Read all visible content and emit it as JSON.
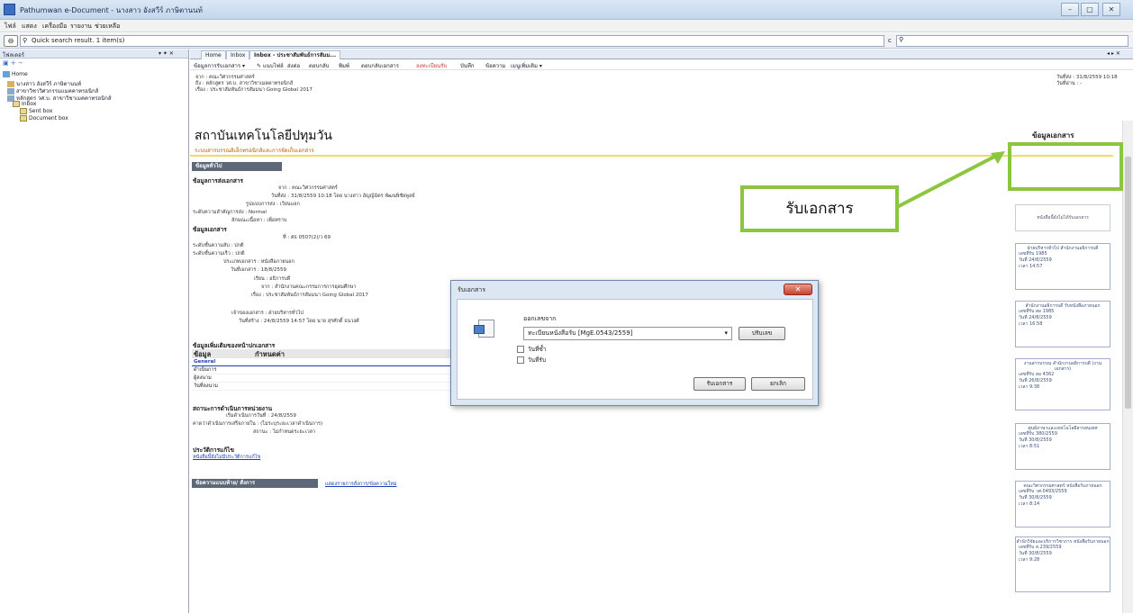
{
  "window": {
    "title": "Pathumwan e-Document - นางสาว อังสวีร์ ภาษิตานนท์",
    "controls": [
      "–",
      "▢",
      "✕"
    ]
  },
  "menubar": {
    "items": [
      "ไฟล์",
      "แสดง",
      "เครื่องมือ",
      "รายงาน",
      "ช่วยเหลือ"
    ]
  },
  "search": {
    "value": "Quick search result. 1 item(s)",
    "dropdown": "c"
  },
  "left_panel": {
    "title": "โฟลเดอร์",
    "controls": "▾ ✦ ✕",
    "tree": [
      {
        "label": "Home",
        "indent": 0
      },
      {
        "label": "นางสาว อังสวีร์ ภาษิตานนท์",
        "indent": 1
      },
      {
        "label": "สาขาวิชาวิศวกรรมแมคคาทรอนิกส์",
        "indent": 1
      },
      {
        "label": "หลักสูตร วศ.บ. สาขาวิชาเมคคาทรอนิกส์",
        "indent": 1
      },
      {
        "label": "Inbox",
        "indent": 2
      },
      {
        "label": "Sent box",
        "indent": 3
      },
      {
        "label": "Document box",
        "indent": 3
      }
    ]
  },
  "tabs": [
    "Home",
    "Inbox",
    "Inbox - ประชาสัมพันธ์การสัมม..."
  ],
  "tab_controls": "◂ ▸ ✕",
  "toolbar": {
    "items": [
      "ข้อมูลการรับเอกสาร ▾",
      "✎ แนบไฟล์",
      "ส่งต่อ",
      "ตอบกลับ",
      "พิมพ์",
      "ตอบกลับเอกสาร",
      "ลงทะเบียนรับ",
      "บันทึก",
      "ข้อความ",
      "เมนูเพิ่มเติม ▾"
    ]
  },
  "meta": {
    "from": "จาก : คณะวิศวกรรมศาสตร์",
    "to": "ถึง : หลักสูตร วศ.บ. สาขาวิชาเมคคาทรอนิกส์",
    "subject": "เรื่อง : ประชาสัมพันธ์การสัมมนา Going Global 2017",
    "date_sent": "วันที่ส่ง : 31/8/2559 10:18",
    "date_read": "วันที่อ่าน : -"
  },
  "doc": {
    "org_title": "สถาบันเทคโนโลยีปทุมวัน",
    "org_sub": "ระบบสารบรรณอิเล็กทรอนิกส์และการจัดเก็บเอกสาร",
    "doc_info_title": "ข้อมูลเอกสาร",
    "general_tab": "ข้อมูลทั่วไป",
    "sender_heading": "ข้อมูลการส่งเอกสาร",
    "sender_lines": [
      "จาก : คณะวิศวกรรมศาสตร์",
      "วันที่ส่ง : 31/8/2559 10:18 โดย นางสาว อัญญ์ฉัตร พัฒนพิชัยพูลย์",
      "รูปแบบการส่ง : เวียนแจก",
      "ระดับความสำคัญการส่ง : Normal",
      "ลักษณะเนื้อหา : เพื่อทราบ"
    ],
    "doc_heading": "ข้อมูลเอกสาร",
    "doc_lines": [
      "ที่ : ศธ 0507(2)/ว 69",
      "ระดับชั้นความลับ : ปกติ",
      "ระดับชั้นความเร็ว : ปกติ",
      "ประเภทเอกสาร : หนังสือภายนอก",
      "วันที่เอกสาร : 18/8/2559",
      "เรียน : อธิการบดี",
      "จาก : สำนักงานคณะกรรมการการอุดมศึกษา",
      "เรื่อง : ประชาสัมพันธ์การสัมมนา Going Global 2017"
    ],
    "owner_lines": [
      "เจ้าของเอกสาร : ฝ่ายบริหารทั่วไป",
      "วันที่สร้าง : 24/8/2559 14:57 โดย นาย สุรศักดิ์ ธนวงศ์"
    ],
    "extra_heading": "ข้อมูลเพิ่มเติมของหน้าปกเอกสาร",
    "param_cols": [
      "ข้อมูล",
      "กำหนดค่า"
    ],
    "param_rows": [
      "General",
      "ดำเนินการ",
      "ผู้ลงนาม",
      "วันที่ลงนาม"
    ],
    "status_heading": "สถานะการดำเนินการหน่วยงาน",
    "status_lines": [
      "เริ่มดำเนินการวันที่ : 24/8/2559",
      "คาดว่าดำเนินการเสร็จภายใน : (ไม่ระบุระยะเวลาดำเนินการ)",
      "สถานะ : ไม่กำหนดระยะเวลา"
    ],
    "history_heading": "ประวัติการแก้ไข",
    "history_link": "หนังสือนี้ยังไม่มีประวัติการแก้ไข",
    "bottom_bar": "ข้อความแนบท้าย/ สั่งการ",
    "bottom_link": "แสดงรายการสั่งการ/ข้อความใหม่"
  },
  "sidebar": {
    "accept_link": "หนังสือนี้ยังไม่ได้รับเอกสาร",
    "routes": [
      {
        "title": "ฝ่ายบริหารทั่วไป สำนักงานอธิการบดี",
        "lines": [
          "เลขที่รับ 1985",
          "วันที่ 24/8/2559",
          "เวลา 14:57"
        ]
      },
      {
        "title": "สำนักงานอธิการบดี รับหนังสือภายนอก",
        "lines": [
          "เลขที่รับ สอ 1985",
          "วันที่ 24/8/2559",
          "เวลา 16:58"
        ]
      },
      {
        "title": "งานสารบรรณ สำนักงานอธิการบดี (งานเอกสาร)",
        "lines": [
          "เลขที่รับ สอ 4362",
          "วันที่ 26/8/2559",
          "เวลา 9:38"
        ]
      },
      {
        "title": "ศูนย์ภาษาและเทคโนโลยีสารสนเทศ",
        "lines": [
          "เลขที่รับ 380/2559",
          "วันที่ 30/8/2559",
          "เวลา 8:51"
        ]
      },
      {
        "title": "คณะวิศวกรรมศาสตร์ หนังสือรับภายนอก",
        "lines": [
          "เลขที่รับ วศ.0493/2559",
          "วันที่ 30/8/2559",
          "เวลา 8:14"
        ]
      },
      {
        "title": "สำนักวิจัยและบริการวิชาการ หนังสือรับภายนอก",
        "lines": [
          "เลขที่รับ ส.239/2559",
          "วันที่ 30/8/2559",
          "เวลา 9:28"
        ]
      }
    ]
  },
  "dialog": {
    "title": "รับเอกสาร",
    "close": "✕",
    "from_label": "ออกเลขจาก",
    "select_value": "ทะเบียนหนังสือรับ [MgE.0543/2559]",
    "adjust_btn": "ปรับเลข",
    "check1": "วันที่ซ้ำ",
    "check2": "วันที่รับ",
    "ok_btn": "รับเอกสาร",
    "cancel_btn": "ยกเลิก"
  },
  "annotation": {
    "callout": "รับเอกสาร",
    "accent_color": "#8cc63f"
  }
}
